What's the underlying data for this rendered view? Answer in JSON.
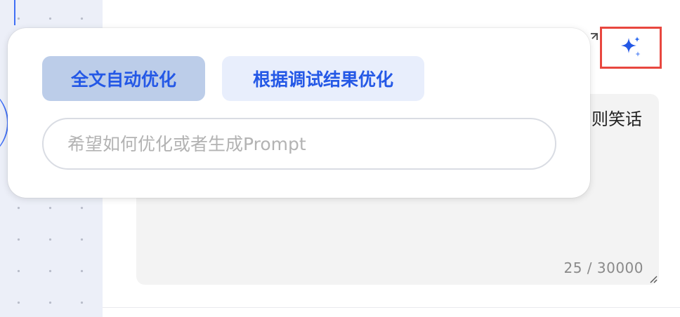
{
  "popover": {
    "chip_full_optimize": "全文自动优化",
    "chip_debug_optimize": "根据调试结果优化",
    "input_placeholder": "希望如何优化或者生成Prompt"
  },
  "prompt_editor": {
    "visible_text_fragment": "则笑话",
    "char_count": "25 / 30000"
  },
  "icons": {
    "ai_button": "sparkle-icon",
    "expand": "expand-icon",
    "resize": "resize-handle-icon"
  },
  "colors": {
    "accent": "#2458e6",
    "ai_button_highlight": "#e8473f",
    "chip_selected_bg": "#bccde9",
    "chip_bg": "#e8eefc"
  }
}
